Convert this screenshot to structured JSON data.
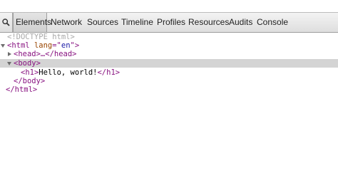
{
  "toolbar": {
    "search_icon": "magnifier-icon",
    "tabs": [
      {
        "label": "Elements",
        "selected": true
      },
      {
        "label": "Network"
      },
      {
        "label": "Sources"
      },
      {
        "label": "Timeline"
      },
      {
        "label": "Profiles"
      },
      {
        "label": "Resources"
      },
      {
        "label": "Audits"
      },
      {
        "label": "Console"
      }
    ]
  },
  "dom_tree": {
    "doctype": "<!DOCTYPE html>",
    "html_open_start": "<html ",
    "html_attr_name": "lang",
    "html_attr_eq": "=\"",
    "html_attr_value": "en",
    "html_attr_end": "\">",
    "head_collapsed": "<head>…</head>",
    "body_open": "<body>",
    "h1_open": "<h1>",
    "h1_text": "Hello, world!",
    "h1_close": "</h1>",
    "body_close": "</body>",
    "html_close": "</html>"
  },
  "colors": {
    "tag": "#881280",
    "attribute_name": "#994500",
    "attribute_value": "#1a1aa6",
    "doctype": "#a8a8a8",
    "selection": "#d4d4d4"
  }
}
